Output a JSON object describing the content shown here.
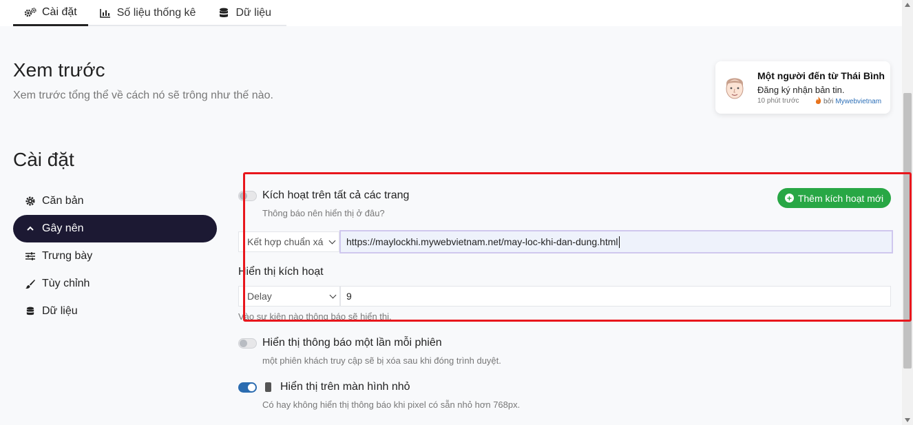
{
  "tabs": [
    {
      "label": "Cài đặt",
      "icon": "gears-icon"
    },
    {
      "label": "Số liệu thống kê",
      "icon": "bar-chart-icon"
    },
    {
      "label": "Dữ liệu",
      "icon": "database-icon"
    }
  ],
  "preview": {
    "title": "Xem trước",
    "subtitle": "Xem trước tổng thể về cách nó sẽ trông như thế nào."
  },
  "notification": {
    "title": "Một người đến từ Thái Bình",
    "description": "Đăng ký nhận bản tin.",
    "time": "10 phút trước",
    "by_prefix": "bởi",
    "brand": "Mywebvietnam"
  },
  "settings": {
    "title": "Cài đặt",
    "nav": [
      {
        "label": "Căn bản",
        "icon": "gear-icon"
      },
      {
        "label": "Gây nên",
        "icon": "chevron-up-icon"
      },
      {
        "label": "Trưng bày",
        "icon": "sliders-icon"
      },
      {
        "label": "Tùy chỉnh",
        "icon": "brush-icon"
      },
      {
        "label": "Dữ liệu",
        "icon": "database-icon"
      }
    ],
    "active_nav": "Gây nên"
  },
  "form": {
    "activate_all": {
      "label": "Kích hoạt trên tất cả các trang",
      "help": "Thông báo nên hiển thị ở đâu?",
      "enabled": false
    },
    "add_button": "Thêm kích hoạt mới",
    "trigger_rule": {
      "select_value": "Kết hợp chuẩn xá",
      "url_value": "https://maylockhi.mywebvietnam.net/may-loc-khi-dan-dung.html"
    },
    "display_trigger": {
      "label": "Hiển thị kích hoạt",
      "select_value": "Delay",
      "input_value": "9",
      "help": "Vào sự kiện nào thông báo sẽ hiển thị."
    },
    "once_per_session": {
      "label": "Hiển thị thông báo một lần mỗi phiên",
      "help": "một phiên khách truy cập sẽ bị xóa sau khi đóng trình duyệt.",
      "enabled": false
    },
    "show_on_mobile": {
      "label": "Hiển thị trên màn hình nhỏ",
      "help": "Có hay không hiển thị thông báo khi pixel có sẵn nhỏ hơn 768px.",
      "enabled": true
    }
  },
  "colors": {
    "active_nav_bg": "#1c1933",
    "add_button_bg": "#28a745",
    "toggle_on": "#2b6cb0",
    "highlight_border": "#e8161c"
  }
}
